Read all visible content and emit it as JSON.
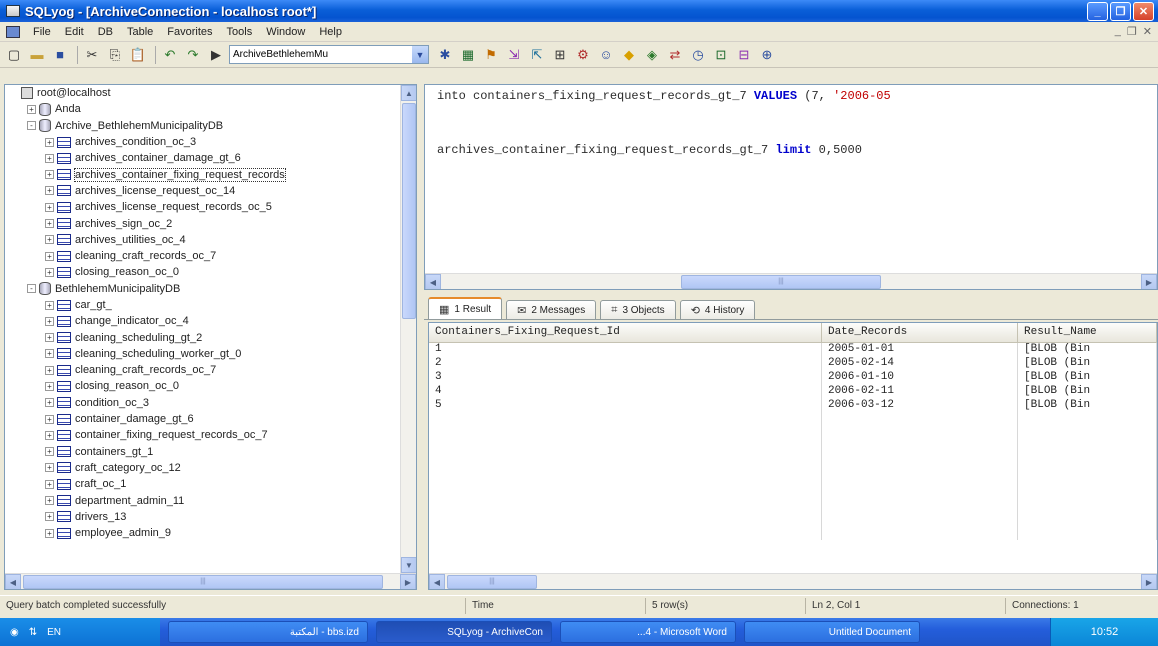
{
  "window": {
    "title": "SQLyog - [ArchiveConnection - localhost root*]"
  },
  "menu": {
    "items": [
      "File",
      "Edit",
      "DB",
      "Table",
      "Favorites",
      "Tools",
      "Window",
      "Help"
    ]
  },
  "toolbar": {
    "database": "ArchiveBethlehemMu"
  },
  "tree": {
    "rows": [
      {
        "indent": 0,
        "expander": "",
        "icon": "server",
        "label": "root@localhost",
        "selected": false
      },
      {
        "indent": 1,
        "expander": "+",
        "icon": "db",
        "label": "Anda",
        "selected": false
      },
      {
        "indent": 1,
        "expander": "-",
        "icon": "db",
        "label": "Archive_BethlehemMunicipalityDB",
        "selected": false
      },
      {
        "indent": 2,
        "expander": "+",
        "icon": "table",
        "label": "archives_condition_oc_3",
        "selected": false
      },
      {
        "indent": 2,
        "expander": "+",
        "icon": "table",
        "label": "archives_container_damage_gt_6",
        "selected": false
      },
      {
        "indent": 2,
        "expander": "+",
        "icon": "table",
        "label": "archives_container_fixing_request_records",
        "selected": true
      },
      {
        "indent": 2,
        "expander": "+",
        "icon": "table",
        "label": "archives_license_request_oc_14",
        "selected": false
      },
      {
        "indent": 2,
        "expander": "+",
        "icon": "table",
        "label": "archives_license_request_records_oc_5",
        "selected": false
      },
      {
        "indent": 2,
        "expander": "+",
        "icon": "table",
        "label": "archives_sign_oc_2",
        "selected": false
      },
      {
        "indent": 2,
        "expander": "+",
        "icon": "table",
        "label": "archives_utilities_oc_4",
        "selected": false
      },
      {
        "indent": 2,
        "expander": "+",
        "icon": "table",
        "label": "cleaning_craft_records_oc_7",
        "selected": false
      },
      {
        "indent": 2,
        "expander": "+",
        "icon": "table",
        "label": "closing_reason_oc_0",
        "selected": false
      },
      {
        "indent": 1,
        "expander": "-",
        "icon": "db",
        "label": "BethlehemMunicipalityDB",
        "selected": false
      },
      {
        "indent": 2,
        "expander": "+",
        "icon": "table",
        "label": "car_gt_",
        "selected": false
      },
      {
        "indent": 2,
        "expander": "+",
        "icon": "table",
        "label": "change_indicator_oc_4",
        "selected": false
      },
      {
        "indent": 2,
        "expander": "+",
        "icon": "table",
        "label": "cleaning_scheduling_gt_2",
        "selected": false
      },
      {
        "indent": 2,
        "expander": "+",
        "icon": "table",
        "label": "cleaning_scheduling_worker_gt_0",
        "selected": false
      },
      {
        "indent": 2,
        "expander": "+",
        "icon": "table",
        "label": "cleaning_craft_records_oc_7",
        "selected": false
      },
      {
        "indent": 2,
        "expander": "+",
        "icon": "table",
        "label": "closing_reason_oc_0",
        "selected": false
      },
      {
        "indent": 2,
        "expander": "+",
        "icon": "table",
        "label": "condition_oc_3",
        "selected": false
      },
      {
        "indent": 2,
        "expander": "+",
        "icon": "table",
        "label": "container_damage_gt_6",
        "selected": false
      },
      {
        "indent": 2,
        "expander": "+",
        "icon": "table",
        "label": "container_fixing_request_records_oc_7",
        "selected": false
      },
      {
        "indent": 2,
        "expander": "+",
        "icon": "table",
        "label": "containers_gt_1",
        "selected": false
      },
      {
        "indent": 2,
        "expander": "+",
        "icon": "table",
        "label": "craft_category_oc_12",
        "selected": false
      },
      {
        "indent": 2,
        "expander": "+",
        "icon": "table",
        "label": "craft_oc_1",
        "selected": false
      },
      {
        "indent": 2,
        "expander": "+",
        "icon": "table",
        "label": "department_admin_11",
        "selected": false
      },
      {
        "indent": 2,
        "expander": "+",
        "icon": "table",
        "label": "drivers_13",
        "selected": false
      },
      {
        "indent": 2,
        "expander": "+",
        "icon": "table",
        "label": "employee_admin_9",
        "selected": false
      }
    ]
  },
  "editor": {
    "line1": {
      "pre": "into containers_fixing_request_records_gt_7 ",
      "kw": "VALUES",
      "post": " (7, ",
      "str": "'2006-05"
    },
    "line2": {
      "pre": "archives_container_fixing_request_records_gt_7 ",
      "kw": "limit",
      "post": " 0,5000"
    }
  },
  "tabs": [
    {
      "icon": "▦",
      "label": "1 Result",
      "active": true
    },
    {
      "icon": "✉",
      "label": "2 Messages",
      "active": false
    },
    {
      "icon": "⌗",
      "label": "3 Objects",
      "active": false
    },
    {
      "icon": "⟲",
      "label": "4 History",
      "active": false
    }
  ],
  "grid": {
    "columns": [
      "Containers_Fixing_Request_Id",
      "Date_Records",
      "Result_Name"
    ],
    "rows": [
      [
        "1",
        "2005-01-01",
        "[BLOB (Bin"
      ],
      [
        "2",
        "2005-02-14",
        "[BLOB (Bin"
      ],
      [
        "3",
        "2006-01-10",
        "[BLOB (Bin"
      ],
      [
        "4",
        "2006-02-11",
        "[BLOB (Bin"
      ],
      [
        "5",
        "2006-03-12",
        "[BLOB (Bin"
      ]
    ]
  },
  "status": {
    "message": "Query batch completed successfully",
    "time": "Time",
    "rows": "5 row(s)",
    "position": "Ln 2, Col 1",
    "connections": "Connections: 1"
  },
  "taskbar": {
    "lang": "EN",
    "tasks": [
      {
        "label": "المكتبة - bbs.izd",
        "active": false
      },
      {
        "label": "SQLyog - ArchiveCon",
        "active": true
      },
      {
        "label": "...4 - Microsoft Word",
        "active": false
      },
      {
        "label": "Untitled Document",
        "active": false
      }
    ],
    "clock": "10:52"
  }
}
